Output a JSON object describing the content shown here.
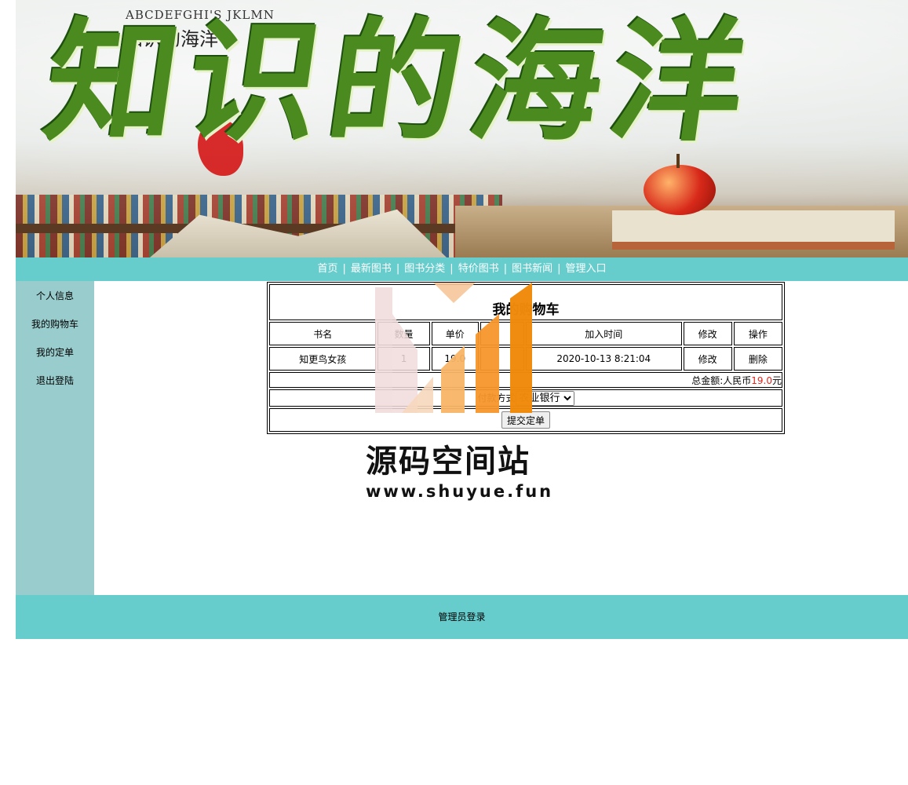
{
  "banner": {
    "title": "知识的海洋",
    "subtitle_latin": "ABCDEFGHI'S  JKLMN",
    "subtitle_cn": "知识的海洋"
  },
  "nav": {
    "items": [
      "首页",
      "最新图书",
      "图书分类",
      "特价图书",
      "图书新闻",
      "管理入口"
    ],
    "separator": "|"
  },
  "sidebar": {
    "items": [
      "个人信息",
      "我的购物车",
      "我的定单",
      "退出登陆"
    ]
  },
  "cart": {
    "title": "我的购物车",
    "headers": [
      "书名",
      "数量",
      "单价",
      "",
      "加入时间",
      "修改",
      "操作"
    ],
    "rows": [
      {
        "name": "知更鸟女孩",
        "qty": "1",
        "price": "19.0",
        "blank": "",
        "added": "2020-10-13 8:21:04",
        "edit": "修改",
        "action": "删除"
      }
    ],
    "total_prefix": "总金额:人民币",
    "total_value": "19.0",
    "total_suffix": "元",
    "payment_label": "付款方式",
    "payment_selected": "农业银行",
    "submit_label": "提交定单"
  },
  "footer": {
    "text": "管理员登录"
  },
  "watermark": {
    "line1": "源码空间站",
    "line2": "www.shuyue.fun"
  },
  "colors": {
    "nav_bg": "#66cccc",
    "sidebar_bg": "#99cccc",
    "total_accent": "#e3241b",
    "watermark_orange": "#f08a0a"
  }
}
